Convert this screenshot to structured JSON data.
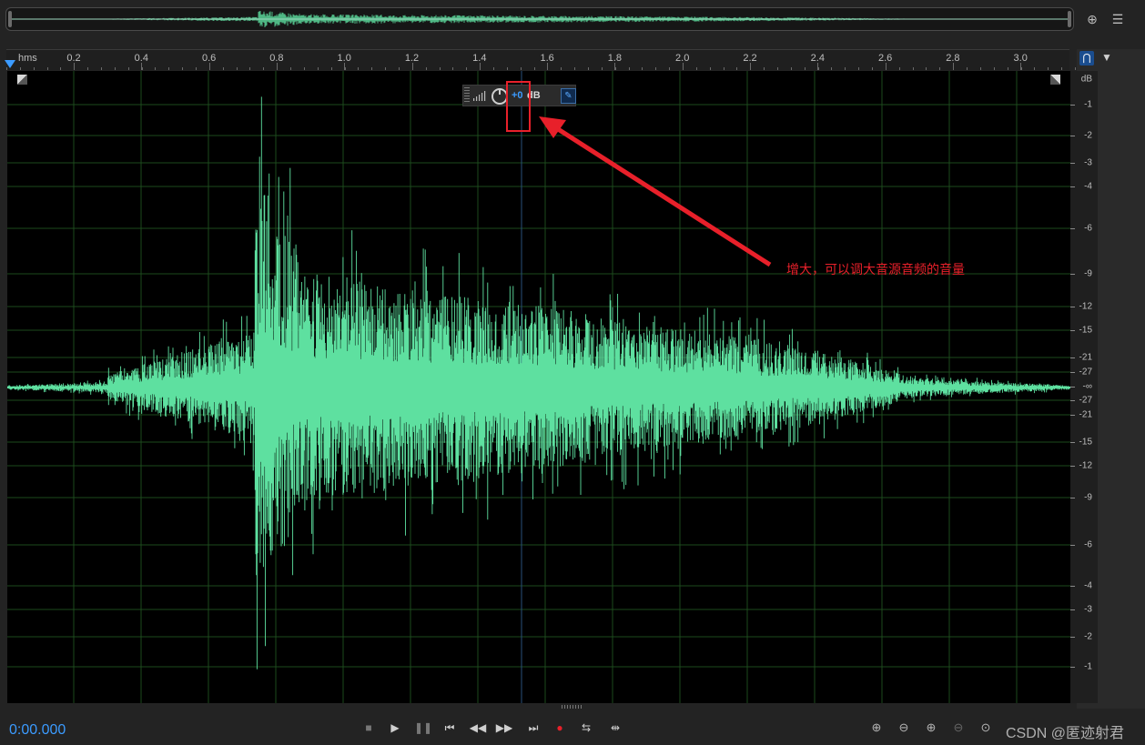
{
  "ruler": {
    "unit_label": "hms",
    "ticks": [
      "0.2",
      "0.4",
      "0.6",
      "0.8",
      "1.0",
      "1.2",
      "1.4",
      "1.6",
      "1.8",
      "2.0",
      "2.2",
      "2.4",
      "2.6",
      "2.8",
      "3.0"
    ]
  },
  "db_scale": {
    "unit_label": "dB",
    "labels_top": [
      "-1",
      "-2",
      "-3",
      "-4",
      "-6",
      "-9",
      "-12",
      "-15",
      "-21",
      "-27",
      "-∞"
    ],
    "labels_bottom": [
      "-27",
      "-21",
      "-15",
      "-12",
      "-9",
      "-6",
      "-4",
      "-3",
      "-2",
      "-1"
    ]
  },
  "hud": {
    "gain_value": "+0",
    "gain_unit": "dB"
  },
  "annotation": {
    "text": "增大，可以调大音源音频的音量"
  },
  "transport": {
    "current_time": "0:00.000",
    "buttons": [
      "stop",
      "play",
      "pause",
      "go-to-start",
      "rewind",
      "fast-forward",
      "go-to-end",
      "record",
      "loop",
      "skip-selection"
    ]
  },
  "zoom_buttons": [
    "zoom-in-amplitude",
    "zoom-out-amplitude",
    "zoom-in-time",
    "zoom-out-time",
    "zoom-full"
  ],
  "watermark": "CSDN @匿迹射君",
  "colors": {
    "waveform": "#5ee0a0",
    "accent": "#3b9bff",
    "annotation": "#e8202a",
    "grid": "#1d4a1d"
  },
  "icons": {
    "overview_zoom": "crosshair-zoom-icon",
    "overview_menu": "menu-icon",
    "snap": "magnet-icon",
    "marker": "marker-pin-icon"
  }
}
